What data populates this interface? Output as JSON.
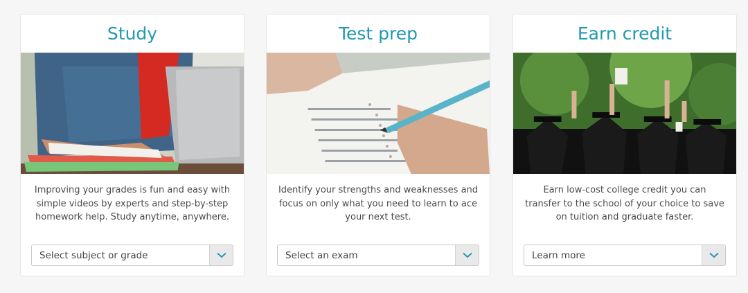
{
  "accent_color": "#2199b0",
  "cards": [
    {
      "title": "Study",
      "description": "Improving your grades is fun and easy with simple videos by experts and step-by-step homework help. Study anytime, anywhere.",
      "dropdown_value": "Select subject or grade",
      "image_desc": "student typing on laptop with notebooks"
    },
    {
      "title": "Test prep",
      "description": "Identify your strengths and weaknesses and focus on only what you need to learn to ace your next test.",
      "dropdown_value": "Select an exam",
      "image_desc": "hand filling in answer sheet with pencil"
    },
    {
      "title": "Earn credit",
      "description": "Earn low-cost college credit you can transfer to the school of your choice to save on tuition and graduate faster.",
      "dropdown_value": "Learn more",
      "image_desc": "graduates raising hands and caps outdoors"
    }
  ]
}
